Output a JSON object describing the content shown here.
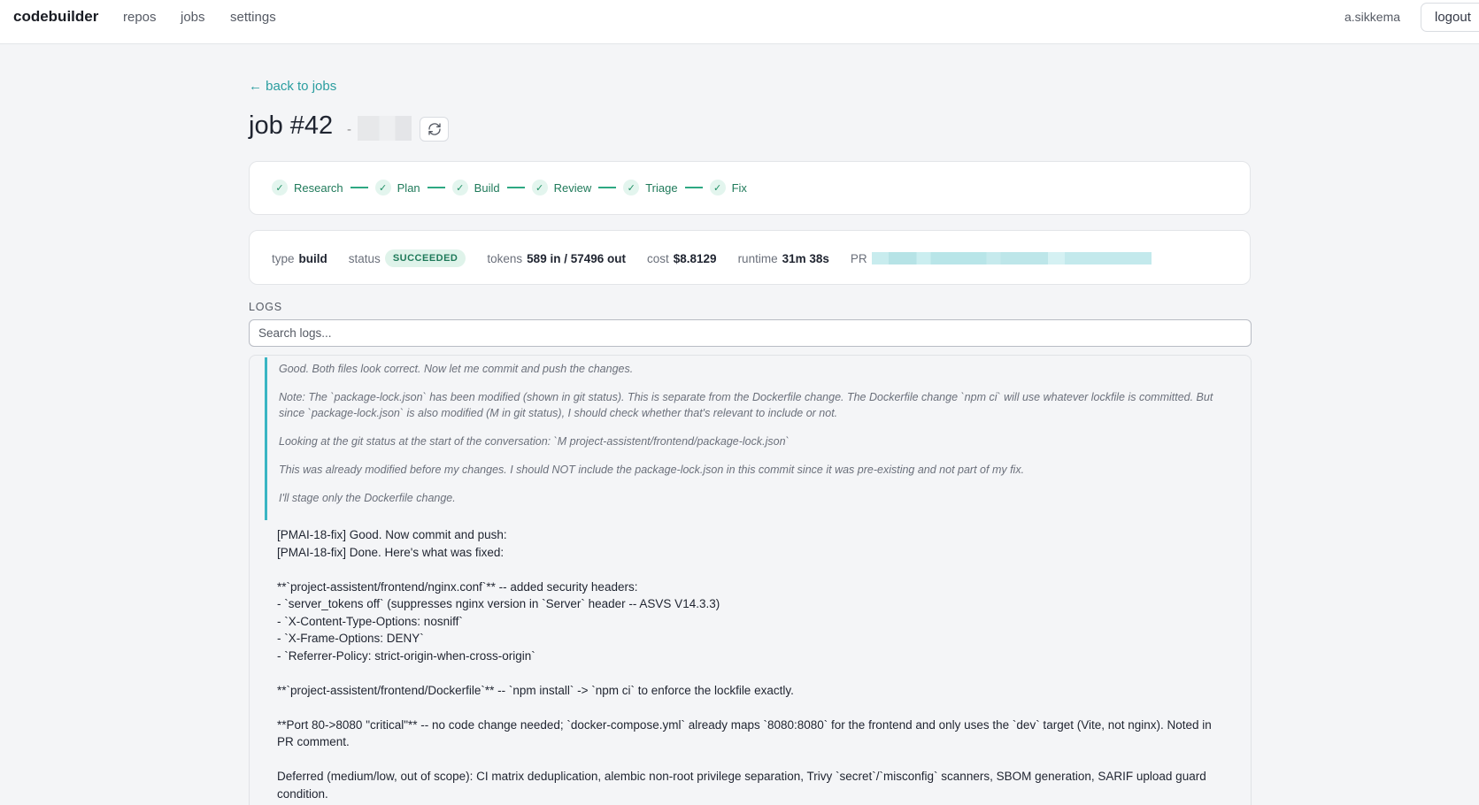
{
  "nav": {
    "brand": "codebuilder",
    "links": [
      "repos",
      "jobs",
      "settings"
    ],
    "user": "a.sikkema",
    "logout": "logout"
  },
  "page": {
    "back_link": "← back to jobs",
    "title": "job #42",
    "title_separator": "-"
  },
  "steps": [
    {
      "label": "Research",
      "done": true
    },
    {
      "label": "Plan",
      "done": true
    },
    {
      "label": "Build",
      "done": true
    },
    {
      "label": "Review",
      "done": true
    },
    {
      "label": "Triage",
      "done": true
    },
    {
      "label": "Fix",
      "done": true
    }
  ],
  "meta": {
    "type_key": "type",
    "type_val": "build",
    "status_key": "status",
    "status_val": "SUCCEEDED",
    "tokens_key": "tokens",
    "tokens_val": "589 in / 57496 out",
    "cost_key": "cost",
    "cost_val": "$8.8129",
    "runtime_key": "runtime",
    "runtime_val": "31m 38s",
    "pr_key": "PR"
  },
  "logs": {
    "label": "LOGS",
    "search_placeholder": "Search logs...",
    "thinking": [
      "Good. Both files look correct. Now let me commit and push the changes.",
      "Note: The `package-lock.json` has been modified (shown in git status). This is separate from the Dockerfile change. The Dockerfile change `npm ci` will use whatever lockfile is committed. But since `package-lock.json` is also modified (M in git status), I should check whether that's relevant to include or not.",
      "Looking at the git status at the start of the conversation: `M project-assistent/frontend/package-lock.json`",
      "This was already modified before my changes. I should NOT include the package-lock.json in this commit since it was pre-existing and not part of my fix.",
      "I'll stage only the Dockerfile change."
    ],
    "output": [
      "[PMAI-18-fix] Good. Now commit and push:",
      "[PMAI-18-fix] Done. Here's what was fixed:",
      "",
      "**`project-assistent/frontend/nginx.conf`** -- added security headers:",
      "- `server_tokens off` (suppresses nginx version in `Server` header -- ASVS V14.3.3)",
      "- `X-Content-Type-Options: nosniff`",
      "- `X-Frame-Options: DENY`",
      "- `Referrer-Policy: strict-origin-when-cross-origin`",
      "",
      "**`project-assistent/frontend/Dockerfile`** -- `npm install` -> `npm ci` to enforce the lockfile exactly.",
      "",
      "**Port 80->8080 \"critical\"** -- no code change needed; `docker-compose.yml` already maps `8080:8080` for the frontend and only uses the `dev` target (Vite, not nginx). Noted in PR comment.",
      "",
      "Deferred (medium/low, out of scope): CI matrix deduplication, alembic non-root privilege separation, Trivy `secret`/`misconfig` scanners, SBOM generation, SARIF upload guard condition."
    ]
  },
  "colors": {
    "accent": "#2a9d9f",
    "success": "#1f7a5a",
    "thinking_border": "#3ab5c3"
  }
}
